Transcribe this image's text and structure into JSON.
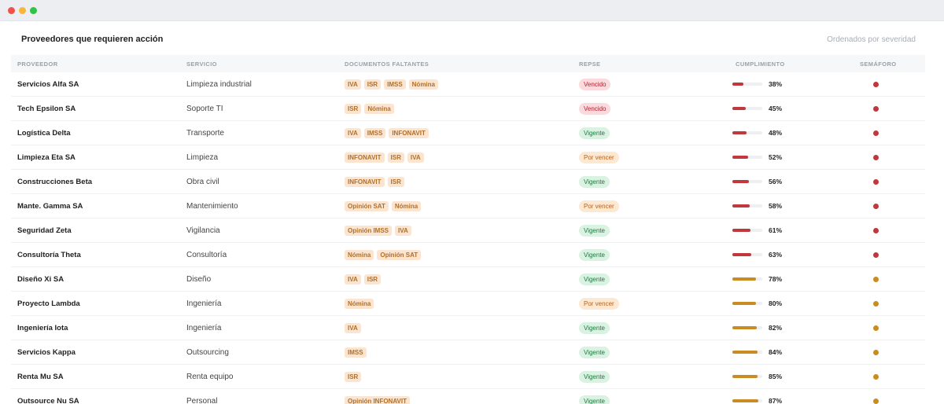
{
  "card": {
    "title": "Proveedores que requieren acción",
    "subtitle": "Ordenados por severidad"
  },
  "colors": {
    "red": "#c0383b",
    "amber": "#c98c22"
  },
  "headers": {
    "proveedor": "PROVEEDOR",
    "servicio": "SERVICIO",
    "documentos": "DOCUMENTOS FALTANTES",
    "repse": "REPSE",
    "cumplimiento": "CUMPLIMIENTO",
    "semaforo": "SEMÁFORO"
  },
  "rows": [
    {
      "proveedor": "Servicios Alfa SA",
      "servicio": "Limpieza industrial",
      "docs": [
        "IVA",
        "ISR",
        "IMSS",
        "Nómina"
      ],
      "repse": "Vencido",
      "repse_status": "vencido",
      "cumplimiento": 38,
      "cumplimiento_label": "38%",
      "semaforo": "red"
    },
    {
      "proveedor": "Tech Epsilon SA",
      "servicio": "Soporte TI",
      "docs": [
        "ISR",
        "Nómina"
      ],
      "repse": "Vencido",
      "repse_status": "vencido",
      "cumplimiento": 45,
      "cumplimiento_label": "45%",
      "semaforo": "red"
    },
    {
      "proveedor": "Logística Delta",
      "servicio": "Transporte",
      "docs": [
        "IVA",
        "IMSS",
        "INFONAVIT"
      ],
      "repse": "Vigente",
      "repse_status": "vigente",
      "cumplimiento": 48,
      "cumplimiento_label": "48%",
      "semaforo": "red"
    },
    {
      "proveedor": "Limpieza Eta SA",
      "servicio": "Limpieza",
      "docs": [
        "INFONAVIT",
        "ISR",
        "IVA"
      ],
      "repse": "Por vencer",
      "repse_status": "porvencer",
      "cumplimiento": 52,
      "cumplimiento_label": "52%",
      "semaforo": "red"
    },
    {
      "proveedor": "Construcciones Beta",
      "servicio": "Obra civil",
      "docs": [
        "INFONAVIT",
        "ISR"
      ],
      "repse": "Vigente",
      "repse_status": "vigente",
      "cumplimiento": 56,
      "cumplimiento_label": "56%",
      "semaforo": "red"
    },
    {
      "proveedor": "Mante. Gamma SA",
      "servicio": "Mantenimiento",
      "docs": [
        "Opinión SAT",
        "Nómina"
      ],
      "repse": "Por vencer",
      "repse_status": "porvencer",
      "cumplimiento": 58,
      "cumplimiento_label": "58%",
      "semaforo": "red"
    },
    {
      "proveedor": "Seguridad Zeta",
      "servicio": "Vigilancia",
      "docs": [
        "Opinión IMSS",
        "IVA"
      ],
      "repse": "Vigente",
      "repse_status": "vigente",
      "cumplimiento": 61,
      "cumplimiento_label": "61%",
      "semaforo": "red"
    },
    {
      "proveedor": "Consultoría Theta",
      "servicio": "Consultoría",
      "docs": [
        "Nómina",
        "Opinión SAT"
      ],
      "repse": "Vigente",
      "repse_status": "vigente",
      "cumplimiento": 63,
      "cumplimiento_label": "63%",
      "semaforo": "red"
    },
    {
      "proveedor": "Diseño Xi SA",
      "servicio": "Diseño",
      "docs": [
        "IVA",
        "ISR"
      ],
      "repse": "Vigente",
      "repse_status": "vigente",
      "cumplimiento": 78,
      "cumplimiento_label": "78%",
      "semaforo": "amber"
    },
    {
      "proveedor": "Proyecto Lambda",
      "servicio": "Ingeniería",
      "docs": [
        "Nómina"
      ],
      "repse": "Por vencer",
      "repse_status": "porvencer",
      "cumplimiento": 80,
      "cumplimiento_label": "80%",
      "semaforo": "amber"
    },
    {
      "proveedor": "Ingeniería Iota",
      "servicio": "Ingeniería",
      "docs": [
        "IVA"
      ],
      "repse": "Vigente",
      "repse_status": "vigente",
      "cumplimiento": 82,
      "cumplimiento_label": "82%",
      "semaforo": "amber"
    },
    {
      "proveedor": "Servicios Kappa",
      "servicio": "Outsourcing",
      "docs": [
        "IMSS"
      ],
      "repse": "Vigente",
      "repse_status": "vigente",
      "cumplimiento": 84,
      "cumplimiento_label": "84%",
      "semaforo": "amber"
    },
    {
      "proveedor": "Renta Mu SA",
      "servicio": "Renta equipo",
      "docs": [
        "ISR"
      ],
      "repse": "Vigente",
      "repse_status": "vigente",
      "cumplimiento": 85,
      "cumplimiento_label": "85%",
      "semaforo": "amber"
    },
    {
      "proveedor": "Outsource Nu SA",
      "servicio": "Personal",
      "docs": [
        "Opinión INFONAVIT"
      ],
      "repse": "Vigente",
      "repse_status": "vigente",
      "cumplimiento": 87,
      "cumplimiento_label": "87%",
      "semaforo": "amber"
    }
  ]
}
